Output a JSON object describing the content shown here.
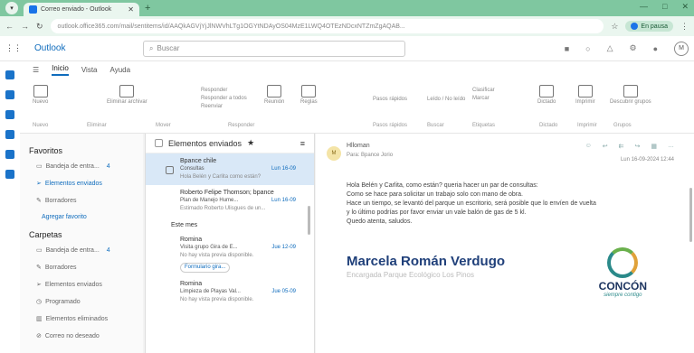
{
  "browser": {
    "tab_title": "Correo enviado - Outlook",
    "url": "outlook.office365.com/mail/sentitems/id/AAQkAGVjYjJlNWVhLTg1OGYtNDAyOS04MzE1LWQ4OTEzNDcxNTZmZgAQAB...",
    "pause_label": "En pausa",
    "new_tab_icon": "+",
    "win_controls": [
      "—",
      "□",
      "✕"
    ]
  },
  "header": {
    "app_name": "Outlook",
    "search_placeholder": "Buscar"
  },
  "menu": {
    "items": [
      "Inicio",
      "Vista",
      "Ayuda"
    ]
  },
  "ribbon": {
    "buttons": [
      "Nuevo",
      "Eliminar archivar",
      "Reunión",
      "Reglas",
      "Dictado",
      "Imprimir",
      "Descubrir grupos"
    ],
    "small_groups": [
      [
        "Responder",
        "Responder a todos",
        "Reenviar"
      ],
      [
        "Pasos rápidos"
      ],
      [
        "Leído / No leído"
      ],
      [
        "Clasificar",
        "Marcar"
      ]
    ],
    "group_labels": [
      "Nuevo",
      "Eliminar",
      "Mover",
      "Responder",
      "Etiquetas",
      "Pasos rápidos",
      "Buscar",
      "Dictado",
      "Imprimir",
      "Grupos"
    ]
  },
  "folders": {
    "favorites_label": "Favoritos",
    "favorites": [
      {
        "label": "Bandeja de entra...",
        "count": "4"
      },
      {
        "label": "Elementos enviados",
        "count": ""
      },
      {
        "label": "Borradores",
        "count": ""
      }
    ],
    "add_favorite": "Agregar favorito",
    "folders_label": "Carpetas",
    "folders": [
      {
        "label": "Bandeja de entra...",
        "count": "4"
      },
      {
        "label": "Borradores",
        "count": ""
      },
      {
        "label": "Elementos enviados",
        "count": ""
      },
      {
        "label": "Programado",
        "count": ""
      },
      {
        "label": "Elementos eliminados",
        "count": ""
      },
      {
        "label": "Correo no deseado",
        "count": ""
      }
    ]
  },
  "list": {
    "title": "Elementos enviados",
    "mails": [
      {
        "from": "Bpance chile",
        "subject": "Consultas",
        "date": "Lun 16-09",
        "preview": "Hola Belén y Carlita como están?"
      },
      {
        "from": "Roberto Felipe Thomson; bpance",
        "subject": "Plan de Manejo Hume...",
        "date": "Lun 16-09",
        "preview": "Estimado Roberto Ulisgues de un..."
      }
    ],
    "section_label": "Este mes",
    "month_mails": [
      {
        "from": "Romina",
        "subject": "Visita grupo Gira de E...",
        "date": "Jue 12-09",
        "preview": "No hay vista previa disponible.",
        "tag": "Formulario gira..."
      },
      {
        "from": "Romina",
        "subject": "Limpieza de Playas Val...",
        "date": "Jue 05-09",
        "preview": "No hay vista previa disponible."
      }
    ]
  },
  "reading": {
    "sender_initials": "M",
    "from": "Hlloman",
    "to": "Para: Bpance  Jorio",
    "date": "Lun 16-09-2024 12:44",
    "body_lines": [
      "Hola Belén y Carlita, como están? queria hacer un par de consultas:",
      "Como se hace para solicitar un trabajo solo con mano de obra.",
      "Hace un tiempo, se levantó del parque un escritorio, será posible que lo envíen de vuelta",
      "y lo último podrías por favor enviar un vale balón de gas de 5 kl.",
      "Quedo atenta, saludos."
    ],
    "signature_name": "Marcela Román Verdugo",
    "signature_role": "Encargada Parque Ecológico Los Pinos",
    "logo_name": "CONCÓN",
    "logo_tagline": "siempre contigo"
  }
}
